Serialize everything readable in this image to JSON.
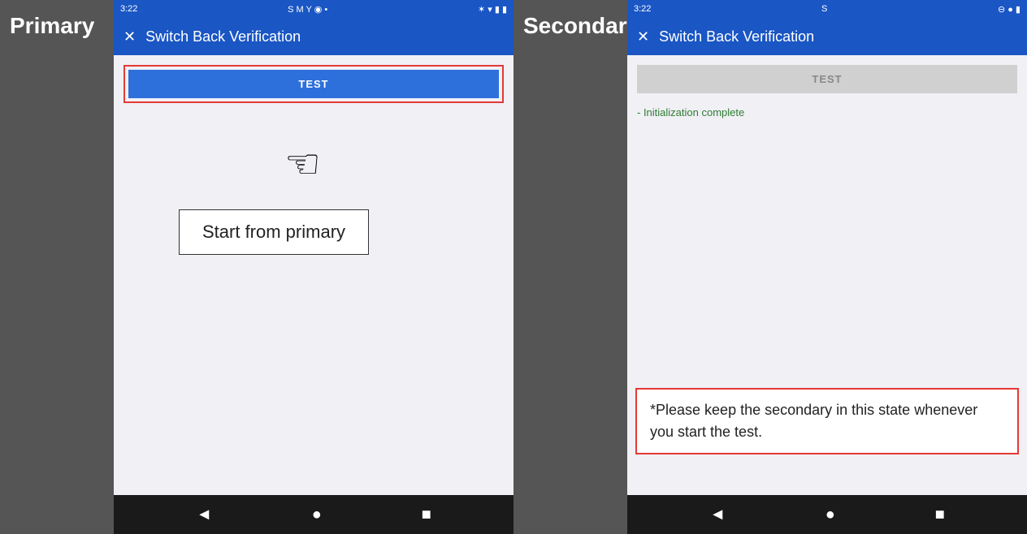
{
  "left": {
    "panel_label": "Primary",
    "status_bar": {
      "time": "3:22",
      "icons_left": "S M Y ◉ •",
      "icons_right": "✶ ▾ ▮ ▮"
    },
    "header": {
      "close_label": "✕",
      "title": "Switch Back Verification"
    },
    "test_button_label": "TEST",
    "start_box_text": "Start from primary"
  },
  "right": {
    "panel_label": "Secondary",
    "status_bar": {
      "time": "3:22",
      "icons_left": "S",
      "icons_right": "⊖ ● ▮"
    },
    "header": {
      "close_label": "✕",
      "title": "Switch Back Verification"
    },
    "test_button_label": "TEST",
    "init_message": "- Initialization complete",
    "note_text": "*Please keep the secondary in this state whenever you start the test."
  },
  "nav": {
    "back": "◄",
    "home": "●",
    "recent": "■"
  }
}
